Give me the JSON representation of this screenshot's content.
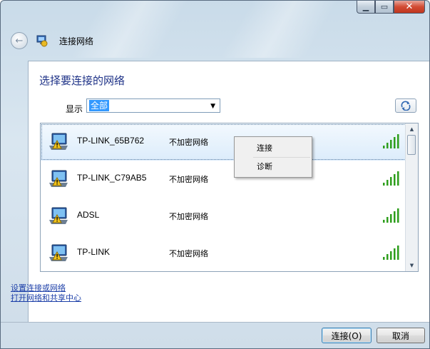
{
  "window": {
    "title": "连接网络",
    "controls": {
      "minimize_icon": "minimize-icon",
      "maximize_icon": "maximize-icon",
      "close_icon": "close-icon"
    }
  },
  "main": {
    "heading": "选择要连接的网络",
    "filter": {
      "label": "显示",
      "selected": "全部"
    },
    "refresh_icon": "refresh-icon"
  },
  "networks": [
    {
      "ssid": "TP-LINK_65B762",
      "security": "不加密网络",
      "signal_bars": 5,
      "selected": true
    },
    {
      "ssid": "TP-LINK_C79AB5",
      "security": "不加密网络",
      "signal_bars": 5,
      "selected": false
    },
    {
      "ssid": "ADSL",
      "security": "不加密网络",
      "signal_bars": 5,
      "selected": false
    },
    {
      "ssid": "TP-LINK",
      "security": "不加密网络",
      "signal_bars": 5,
      "selected": false
    }
  ],
  "context_menu": {
    "items": [
      "连接",
      "诊断"
    ]
  },
  "links": {
    "setup": "设置连接或网络",
    "sharing_center": "打开网络和共享中心"
  },
  "buttons": {
    "connect": "连接(O)",
    "cancel": "取消"
  },
  "colors": {
    "heading": "#1e3287",
    "link": "#1c3fa8",
    "signal": "#2e9e1c",
    "selection": "#3399ff"
  }
}
